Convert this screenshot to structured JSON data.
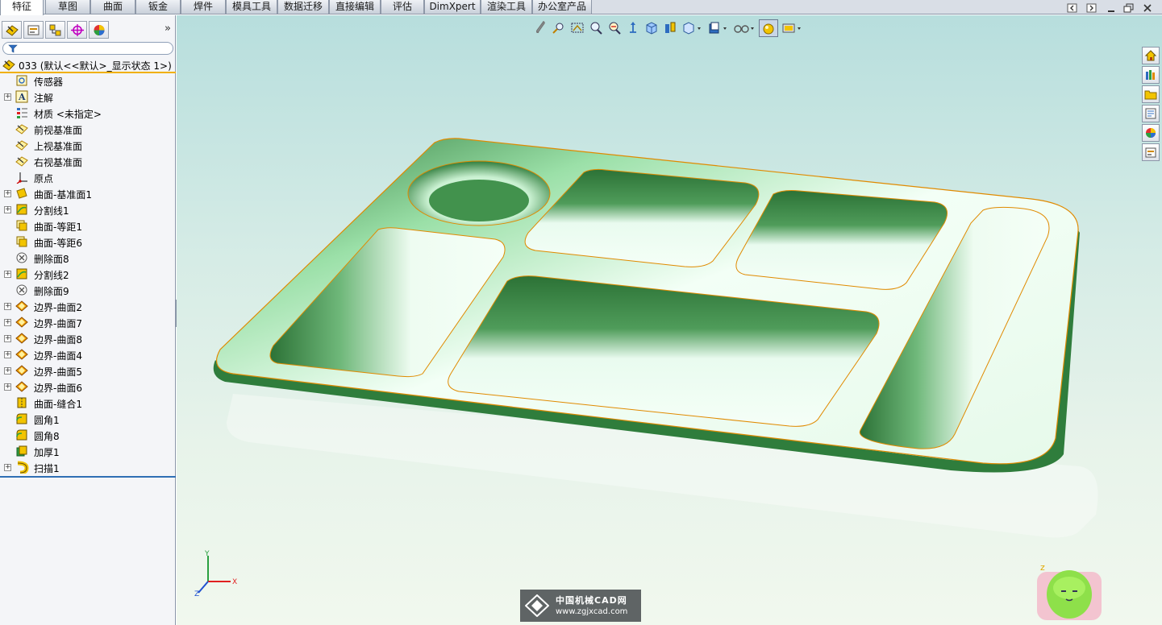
{
  "tabs": [
    {
      "label": "特征",
      "active": true
    },
    {
      "label": "草图",
      "active": false
    },
    {
      "label": "曲面",
      "active": false
    },
    {
      "label": "钣金",
      "active": false
    },
    {
      "label": "焊件",
      "active": false
    },
    {
      "label": "模具工具",
      "active": false
    },
    {
      "label": "数据迁移",
      "active": false
    },
    {
      "label": "直接编辑",
      "active": false
    },
    {
      "label": "评估",
      "active": false
    },
    {
      "label": "DimXpert",
      "active": false
    },
    {
      "label": "渲染工具",
      "active": false
    },
    {
      "label": "办公室产品",
      "active": false
    }
  ],
  "window_controls": [
    "restore-left-icon",
    "restore-right-icon",
    "minimize-icon",
    "maximize-icon",
    "close-icon"
  ],
  "panel": {
    "tab_icons": [
      "feature-manager-icon",
      "property-manager-icon",
      "configuration-manager-icon",
      "dimxpert-manager-icon",
      "display-manager-icon"
    ],
    "expand_glyph": "»",
    "root_label": "033  (默认<<默认>_显示状态 1>)",
    "tree": [
      {
        "label": "传感器",
        "icon": "sensor-icon",
        "expandable": false
      },
      {
        "label": "注解",
        "icon": "annotation-icon",
        "expandable": true
      },
      {
        "label": "材质 <未指定>",
        "icon": "material-icon",
        "expandable": false
      },
      {
        "label": "前视基准面",
        "icon": "plane-icon",
        "expandable": false
      },
      {
        "label": "上视基准面",
        "icon": "plane-icon",
        "expandable": false
      },
      {
        "label": "右视基准面",
        "icon": "plane-icon",
        "expandable": false
      },
      {
        "label": "原点",
        "icon": "origin-icon",
        "expandable": false
      },
      {
        "label": "曲面-基准面1",
        "icon": "surface-plane-icon",
        "expandable": true
      },
      {
        "label": "分割线1",
        "icon": "split-line-icon",
        "expandable": true
      },
      {
        "label": "曲面-等距1",
        "icon": "surface-offset-icon",
        "expandable": false
      },
      {
        "label": "曲面-等距6",
        "icon": "surface-offset-icon",
        "expandable": false
      },
      {
        "label": "删除面8",
        "icon": "delete-face-icon",
        "expandable": false
      },
      {
        "label": "分割线2",
        "icon": "split-line-icon",
        "expandable": true
      },
      {
        "label": "删除面9",
        "icon": "delete-face-icon",
        "expandable": false
      },
      {
        "label": "边界-曲面2",
        "icon": "boundary-surface-icon",
        "expandable": true
      },
      {
        "label": "边界-曲面7",
        "icon": "boundary-surface-icon",
        "expandable": true
      },
      {
        "label": "边界-曲面8",
        "icon": "boundary-surface-icon",
        "expandable": true
      },
      {
        "label": "边界-曲面4",
        "icon": "boundary-surface-icon",
        "expandable": true
      },
      {
        "label": "边界-曲面5",
        "icon": "boundary-surface-icon",
        "expandable": true
      },
      {
        "label": "边界-曲面6",
        "icon": "boundary-surface-icon",
        "expandable": true
      },
      {
        "label": "曲面-缝合1",
        "icon": "knit-surface-icon",
        "expandable": false
      },
      {
        "label": "圆角1",
        "icon": "fillet-icon",
        "expandable": false
      },
      {
        "label": "圆角8",
        "icon": "fillet-icon",
        "expandable": false
      },
      {
        "label": "加厚1",
        "icon": "thicken-icon",
        "expandable": false
      },
      {
        "label": "扫描1",
        "icon": "sweep-icon",
        "expandable": true
      }
    ]
  },
  "heads_up_toolbar": [
    "clip-icon",
    "zoom-to-fit-icon",
    "zoom-area-icon",
    "zoom-in-out-icon",
    "zoom-selection-icon",
    "rotate-view-icon",
    "view-orientation-icon",
    "section-view-icon",
    "display-style-icon",
    "hide-show-icon",
    "edit-appearance-icon",
    "apply-scene-icon",
    "view-settings-icon"
  ],
  "task_pane": [
    "home-icon",
    "design-library-icon",
    "file-explorer-icon",
    "view-palette-icon",
    "appearances-icon",
    "custom-properties-icon"
  ],
  "triad": {
    "x": "X",
    "y": "Y",
    "z": "Z"
  },
  "watermark": {
    "title": "中国机械CAD网",
    "url": "www.zgjxcad.com"
  },
  "colors": {
    "model_green": "#2f7d3c",
    "model_light": "#e9fbef",
    "edge_orange": "#e08a00"
  }
}
